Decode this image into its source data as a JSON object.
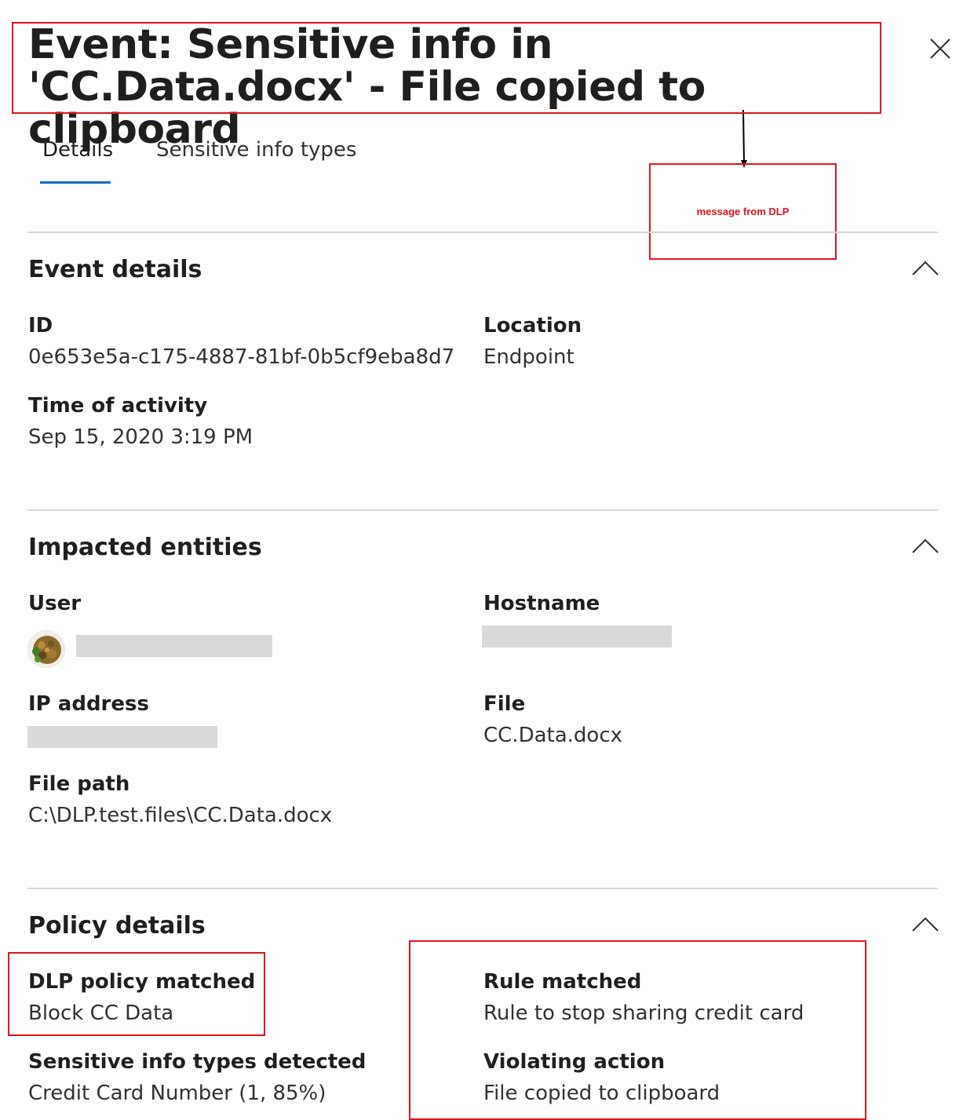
{
  "panel": {
    "title": "Event: Sensitive info in 'CC.Data.docx' - File copied to clipboard",
    "close_icon": "close-icon"
  },
  "tabs": [
    {
      "label": "Details",
      "active": true
    },
    {
      "label": "Sensitive info types",
      "active": false
    }
  ],
  "annotations": {
    "dlp_message": "message from DLP",
    "color": "#e0141e"
  },
  "event_details": {
    "title": "Event details",
    "id_label": "ID",
    "id_value": "0e653e5a-c175-4887-81bf-0b5cf9eba8d7",
    "location_label": "Location",
    "location_value": "Endpoint",
    "time_label": "Time of activity",
    "time_value": "Sep 15, 2020 3:19 PM"
  },
  "impacted_entities": {
    "title": "Impacted entities",
    "user_label": "User",
    "hostname_label": "Hostname",
    "ip_label": "IP address",
    "file_label": "File",
    "file_value": "CC.Data.docx",
    "file_path_label": "File path",
    "file_path_value": "C:\\DLP.test.files\\CC.Data.docx"
  },
  "policy_details": {
    "title": "Policy details",
    "dlp_policy_label": "DLP policy matched",
    "dlp_policy_value": "Block CC Data",
    "rule_label": "Rule matched",
    "rule_value": "Rule to stop sharing credit card",
    "sit_label": "Sensitive info types detected",
    "sit_value": "Credit Card Number (1, 85%)",
    "violating_label": "Violating action",
    "violating_value": "File copied to clipboard"
  },
  "colors": {
    "accent": "#0f6cbd",
    "annotation_red": "#e0141e",
    "divider": "#d6d6d6",
    "redaction": "#d9d9d9"
  }
}
